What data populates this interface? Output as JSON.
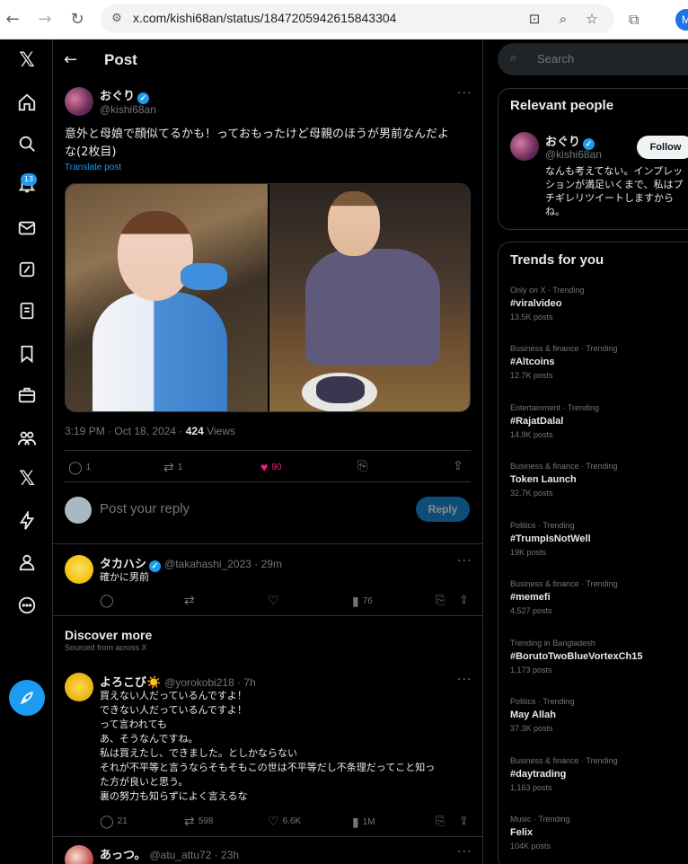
{
  "browser": {
    "url": "x.com/kishi68an/status/1847205942615843304",
    "profile_initial": "M"
  },
  "leftnav": {
    "notification_count": "13",
    "items": [
      "x-logo-icon",
      "home-icon",
      "search-icon",
      "bell-icon",
      "mail-icon",
      "grok-icon",
      "lists-icon",
      "bookmark-icon",
      "jobs-icon",
      "communities-icon",
      "premium-x-icon",
      "lightning-icon",
      "profile-icon",
      "more-icon"
    ]
  },
  "header": {
    "title": "Post"
  },
  "post": {
    "author_name": "おぐり",
    "author_handle": "@kishi68an",
    "text_line1": "意外と母娘で顔似てるかも！っておもったけど母親のほうが男前なんだよ",
    "text_line2": "な(2枚目)",
    "translate_label": "Translate post",
    "time": "3:19 PM · Oct 18, 2024 · ",
    "views_count": "424",
    "views_label": " Views",
    "replies": "1",
    "reposts": "1",
    "likes": "90"
  },
  "reply_box": {
    "placeholder": "Post your reply",
    "button": "Reply"
  },
  "replies": [
    {
      "name": "タカハシ",
      "handle": "@takahashi_2023 · 29m",
      "text": "確かに男前",
      "views": "76"
    }
  ],
  "discover": {
    "title": "Discover more",
    "subtitle": "Sourced from across X",
    "tweets": [
      {
        "name": "よろこび☀️",
        "handle": "@yorokobi218 · 7h",
        "text": "買えない人だっているんですよ！\nできない人だっているんですよ！\nって言われても\nあ、そうなんですね。\n私は買えたし、できました。としかならない\nそれが不平等と言うならそもそもこの世は不平等だし不条理だってこと知っ\nた方が良いと思う。\n裏の努力も知らずによく言えるな",
        "replies": "21",
        "reposts": "598",
        "likes": "6.6K",
        "views": "1M"
      },
      {
        "name": "あっつ。",
        "handle": "@atu_attu72 · 23h"
      }
    ]
  },
  "search": {
    "placeholder": "Search"
  },
  "relevant": {
    "title": "Relevant people",
    "name": "おぐり",
    "handle": "@kishi68an",
    "follow_label": "Follow",
    "bio": "なんも考えてない。インプレッションが満足いくまで、私はプチギレリツイートしますからね。"
  },
  "trends": {
    "title": "Trends for you",
    "items": [
      {
        "context": "Only on X · Trending",
        "name": "#viralvideo",
        "count": "13.5K posts"
      },
      {
        "context": "Business & finance · Trending",
        "name": "#Altcoins",
        "count": "12.7K posts"
      },
      {
        "context": "Entertainment · Trending",
        "name": "#RajatDalal",
        "count": "14.9K posts"
      },
      {
        "context": "Business & finance · Trending",
        "name": "Token Launch",
        "count": "32.7K posts"
      },
      {
        "context": "Politics · Trending",
        "name": "#TrumpIsNotWell",
        "count": "19K posts"
      },
      {
        "context": "Business & finance · Trending",
        "name": "#memefi",
        "count": "4,527 posts"
      },
      {
        "context": "Trending in Bangladesh",
        "name": "#BorutoTwoBlueVortexCh15",
        "count": "1,173 posts"
      },
      {
        "context": "Politics · Trending",
        "name": "May Allah",
        "count": "37.3K posts"
      },
      {
        "context": "Business & finance · Trending",
        "name": "#daytrading",
        "count": "1,163 posts"
      },
      {
        "context": "Music · Trending",
        "name": "Felix",
        "count": "104K posts"
      }
    ]
  },
  "colors": {
    "accent": "#1d9bf0",
    "like": "#f91880",
    "background": "#000000",
    "border": "#2f3336"
  }
}
